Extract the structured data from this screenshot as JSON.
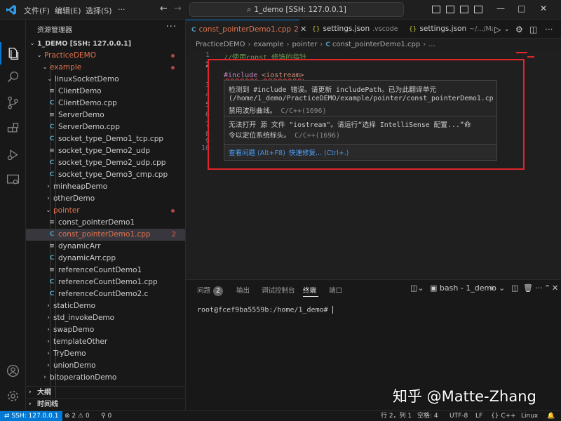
{
  "titlebar": {
    "menus": [
      "文件(F)",
      "编辑(E)",
      "选择(S)"
    ],
    "more": "···",
    "command_center": "1_demo [SSH: 127.0.0.1]"
  },
  "sidebar": {
    "header": "资源管理器",
    "more": "···",
    "root": "1_DEMO [SSH: 127.0.0.1]",
    "items": [
      {
        "label": "PracticeDEMO"
      },
      {
        "label": "example"
      },
      {
        "label": "linuxSocketDemo"
      },
      {
        "label": "ClientDemo"
      },
      {
        "label": "ClientDemo.cpp"
      },
      {
        "label": "ServerDemo"
      },
      {
        "label": "ServerDemo.cpp"
      },
      {
        "label": "socket_type_Demo1_tcp.cpp"
      },
      {
        "label": "socket_type_Demo2_udp"
      },
      {
        "label": "socket_type_Demo2_udp.cpp"
      },
      {
        "label": "socket_type_Demo3_cmp.cpp"
      },
      {
        "label": "minheapDemo"
      },
      {
        "label": "otherDemo"
      },
      {
        "label": "pointer"
      },
      {
        "label": "const_pointerDemo1"
      },
      {
        "label": "const_pointerDemo1.cpp",
        "count": "2"
      },
      {
        "label": "dynamicArr"
      },
      {
        "label": "dynamicArr.cpp"
      },
      {
        "label": "referenceCountDemo1"
      },
      {
        "label": "referenceCountDemo1.cpp"
      },
      {
        "label": "referenceCountDemo2.c"
      },
      {
        "label": "staticDemo"
      },
      {
        "label": "std_invokeDemo"
      },
      {
        "label": "swapDemo"
      },
      {
        "label": "templateOther"
      },
      {
        "label": "TryDemo"
      },
      {
        "label": "unionDemo"
      },
      {
        "label": "bitoperationDemo"
      }
    ],
    "outline": "大纲",
    "timeline": "时间线"
  },
  "tabs": [
    {
      "label": "const_pointerDemo1.cpp",
      "count": "2"
    },
    {
      "label": "settings.json",
      "path": ".vscode"
    },
    {
      "label": "settings.json",
      "path": "~/.../Mach"
    }
  ],
  "breadcrumb": [
    "PracticeDEMO",
    "example",
    "pointer",
    "const_pointerDemo1.cpp",
    "..."
  ],
  "editor": {
    "line_numbers": [
      "1",
      "2",
      "3",
      "4",
      "5",
      "6",
      "7",
      "8",
      "9",
      "10"
    ],
    "line1": "//使用const 修饰的指针",
    "include_kw": "#include",
    "include_file": "<iostream>"
  },
  "hover": {
    "msg1_line1": "检测到 #include 错误。请更新 includePath。已为此翻译单元",
    "msg1_line2": "(/home/1_demo/PracticeDEMO/example/pointer/const_pointerDemo1.cp",
    "msg1_line3": "禁用波形曲线。",
    "msg1_src": "C/C++(1696)",
    "msg2_line1": "无法打开 源 文件 \"iostream\"。请运行“选择 IntelliSense 配置...”命",
    "msg2_line2": "令以定位系统标头。",
    "msg2_src": "C/C++(1696)",
    "action_view": "查看问题",
    "action_view_kb": "(Alt+F8)",
    "action_fix": "快速修复...",
    "action_fix_kb": "(Ctrl+.)"
  },
  "panel": {
    "tabs": [
      "问题",
      "输出",
      "调试控制台",
      "终端",
      "端口"
    ],
    "problems_count": "2",
    "terminal_name": "bash - 1_demo",
    "prompt": "root@fcef9ba5559b:/home/1_demo#"
  },
  "watermark": "知乎 @Matte-Zhang",
  "statusbar": {
    "remote": "SSH: 127.0.0.1",
    "errors": "2",
    "warnings": "0",
    "ports": "0",
    "position": "行 2，列 1",
    "spaces": "空格: 4",
    "encoding": "UTF-8",
    "eol": "LF",
    "language": "C++",
    "platform": "Linux"
  },
  "colors": {
    "accent": "#0078d4",
    "error": "#e0262b",
    "folder_modified": "#e2734f"
  }
}
